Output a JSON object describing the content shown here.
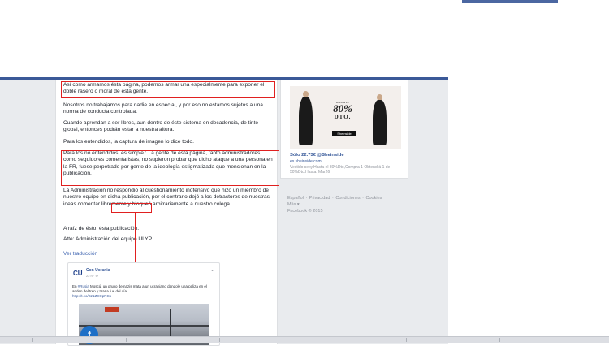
{
  "post": {
    "paragraphs": [
      "Así como armamos ésta página, podemos armar una especialmente para exponer el doble rasero o moral de ésta gente.",
      "Nosotros no trabajamos para nadie en especial, y por eso no estamos sujetos a una norma de conducta controlada.",
      "Cuando aprendan a ser libres, aun dentro de éste sistema en decadencia, de tinte global, entonces podrán estar a nuestra altura.",
      "Para los entendidos, la captura de imagen lo dice todo.",
      "Para los no entendidos, es simple : La gente de ésta página, tanto administradores, como seguidores comentaristas, no supieron probar que dicho ataque a una persona en la FR, fuese perpetrado por gente de la ideología estigmatizada que mencionan en la publicación.",
      "La Administración no respondió al cuestionamiento inofensivo que hizo un miembro de nuestro equipo en dicha publicación, por el contrario dejó a los detractores de nuestras ideas comentar libremente y bloqueó arbitrariamente a nuestro colega.",
      "A raíz de ésto, ésta publicación.",
      "Atte: Administración del equipo ULYP."
    ],
    "see_translation": "Ver traducción",
    "shared": {
      "logo": "CU",
      "page_name": "Con Ucrania",
      "time": "22 h · ⚙",
      "body_prefix": "En ",
      "hashtag": "#Rusia",
      "body_rest": " Moscú, un grupo de nazis mata a un ucraniano dandole una paliza en el anden del tren y tirarla fue del día.",
      "link": "http://t.co/Bz1ZEOpRCs",
      "photo_badge": "f"
    }
  },
  "ad": {
    "promo_small": "HASTA EL",
    "promo_big": "80%",
    "promo_dto": "DTO.",
    "brand": "Sheinside",
    "title": "Sólo 22.73€ @Sheinside",
    "domain": "es.sheinside.com",
    "desc": "Vestido sexy,Hasta el 80%Dto,Compra 1 Obtendrá 1 de 50%Dto.Hasta: Mar26"
  },
  "footer": {
    "links": [
      "Español",
      "Privacidad",
      "Condiciones",
      "Cookies"
    ],
    "more": "Más ▾",
    "copyright": "Facebook © 2015"
  },
  "colors": {
    "fb_blue": "#3b5998",
    "highlight_red": "#e02020",
    "link_blue": "#365899"
  }
}
